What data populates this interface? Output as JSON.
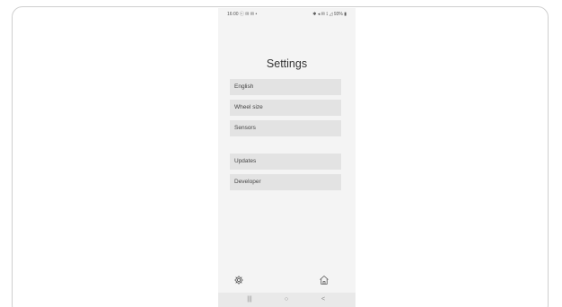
{
  "status_bar": {
    "left_text": "16:00 ⓒ ✉ ✉ •",
    "right_text": "✱ ◂ ✉ ⟟ ◿ 93% ▮"
  },
  "screen": {
    "title": "Settings"
  },
  "menu": {
    "items": [
      {
        "label": "English"
      },
      {
        "label": "Wheel size"
      },
      {
        "label": "Sensors"
      },
      {
        "label": "Updates"
      },
      {
        "label": "Developer"
      }
    ]
  },
  "bottom_nav": {
    "settings_icon": "gear-icon",
    "home_icon": "home-icon"
  },
  "system_nav": {
    "recents_glyph": "|||",
    "home_glyph": "○",
    "back_glyph": "<"
  }
}
